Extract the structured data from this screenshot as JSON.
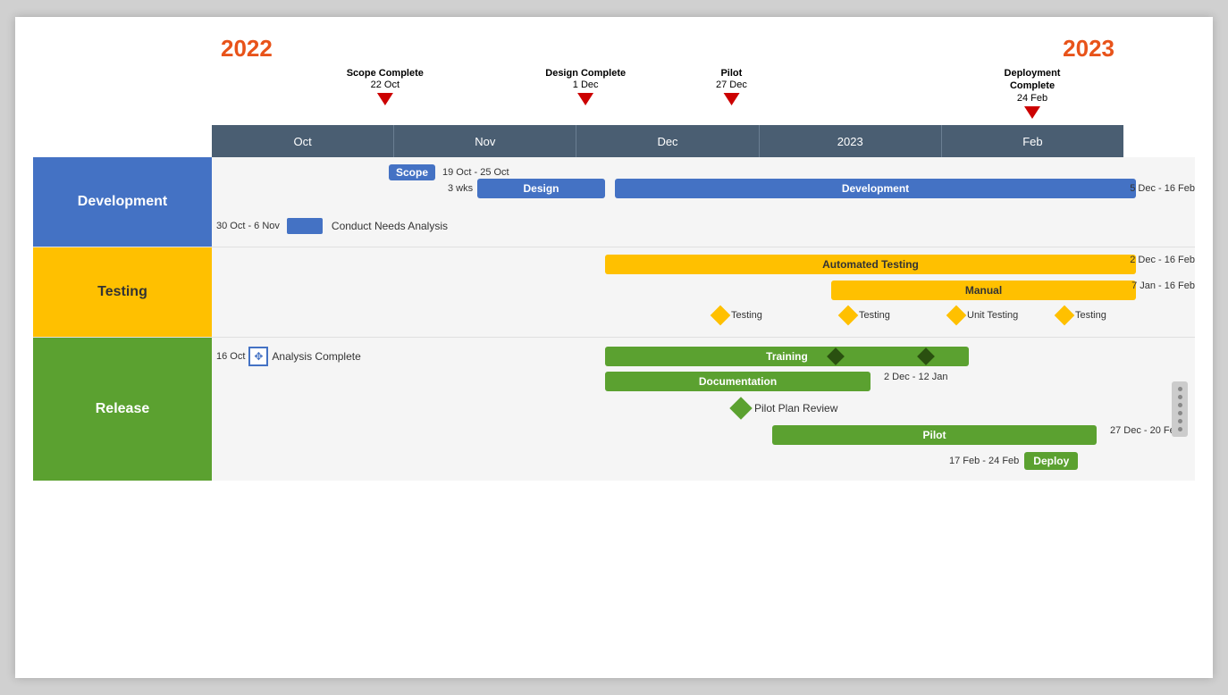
{
  "years": {
    "left": "2022",
    "right": "2023"
  },
  "milestones": [
    {
      "label": "Scope Complete",
      "date": "22 Oct",
      "left_pct": 19
    },
    {
      "label": "Design Complete",
      "date": "1 Dec",
      "left_pct": 41
    },
    {
      "label": "Pilot",
      "date": "27 Dec",
      "left_pct": 57
    },
    {
      "label": "Deployment Complete",
      "date": "24 Feb",
      "left_pct": 90
    }
  ],
  "months": [
    "Oct",
    "Nov",
    "Dec",
    "2023",
    "Feb"
  ],
  "rows": {
    "development": {
      "label": "Development",
      "items": [
        {
          "type": "scope_badge",
          "text": "Scope",
          "date_range": "19 Oct - 25 Oct"
        },
        {
          "type": "bar_blue",
          "text": "Design",
          "label_left": "3 wks"
        },
        {
          "type": "bar_blue_wide",
          "text": "Development",
          "date_range": "5 Dec - 16 Feb"
        },
        {
          "type": "bar_blue_small",
          "text": "",
          "date_range": "30 Oct - 6 Nov",
          "suffix": "Conduct Needs Analysis"
        }
      ]
    },
    "testing": {
      "label": "Testing",
      "items": [
        {
          "type": "bar_gold_wide",
          "text": "Automated Testing",
          "date_range": "2 Dec - 16 Feb"
        },
        {
          "type": "bar_gold_medium",
          "text": "Manual",
          "date_range": "7 Jan - 16 Feb"
        },
        {
          "type": "diamonds",
          "labels": [
            "Testing",
            "Testing",
            "Unit Testing",
            "Testing"
          ]
        }
      ]
    },
    "release": {
      "label": "Release",
      "items": [
        {
          "type": "move_cursor_and_text",
          "date": "16 Oct",
          "text": "Analysis Complete"
        },
        {
          "type": "bar_green_training",
          "text": "Training"
        },
        {
          "type": "bar_green_doc",
          "text": "Documentation",
          "date_range": "2 Dec - 12 Jan"
        },
        {
          "type": "diamond_green",
          "text": "Pilot Plan Review"
        },
        {
          "type": "bar_green_pilot",
          "text": "Pilot",
          "date_range": "27 Dec - 20 Feb"
        },
        {
          "type": "deploy_badge",
          "text": "Deploy",
          "date_range": "17 Feb - 24 Feb"
        }
      ]
    }
  }
}
